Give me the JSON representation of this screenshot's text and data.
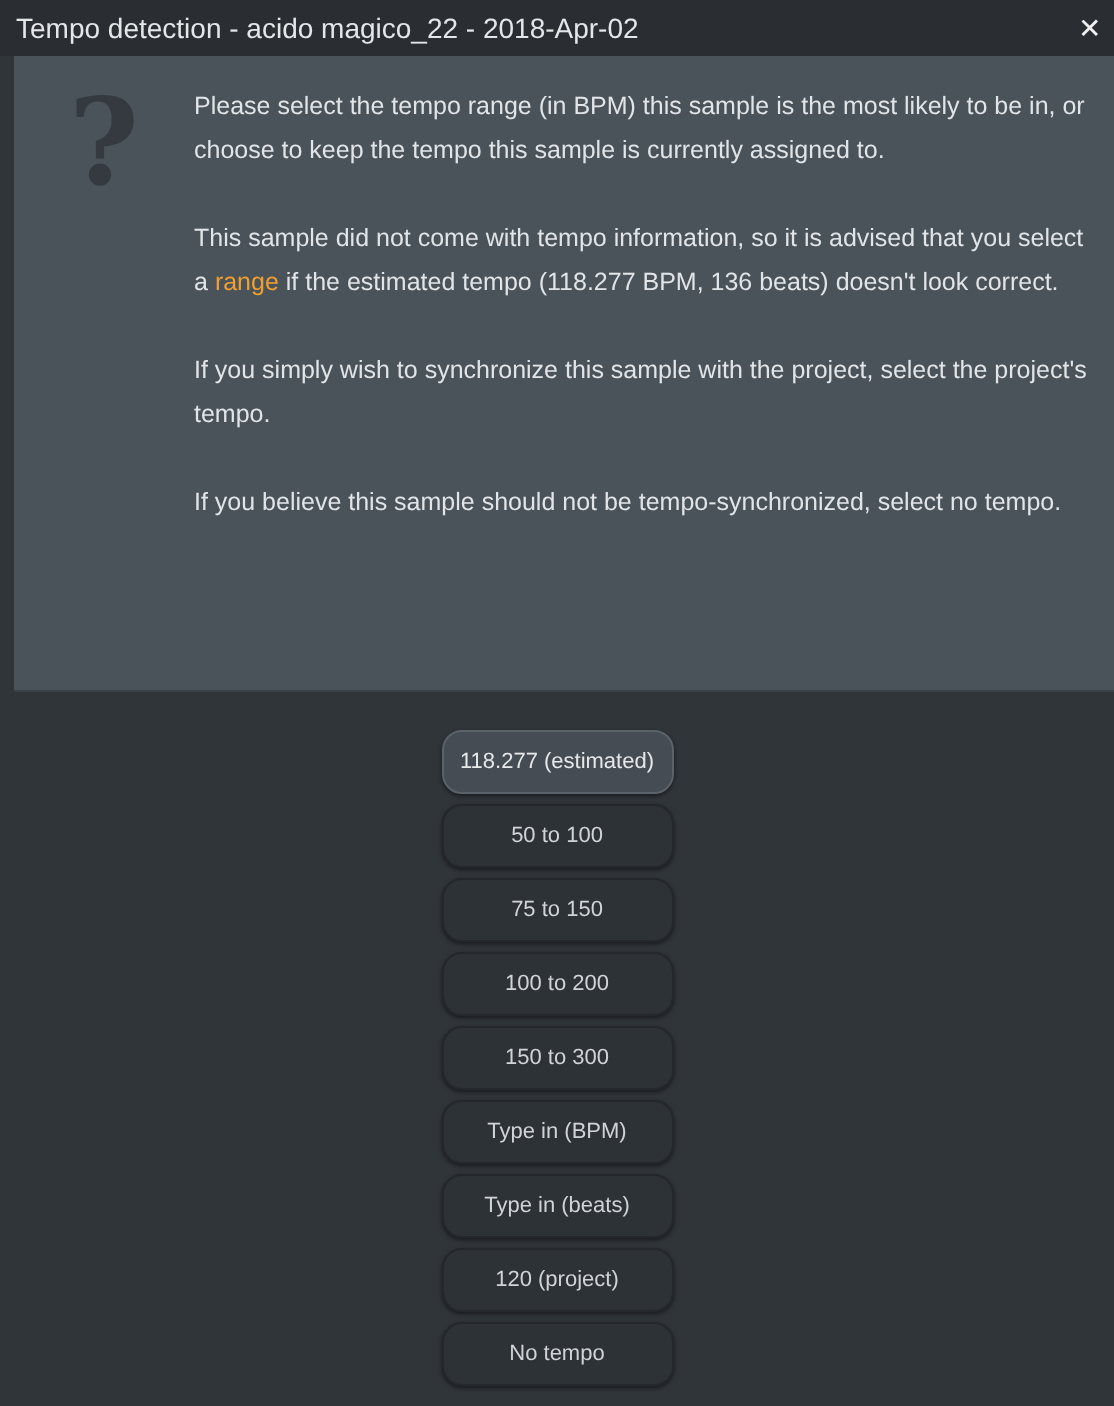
{
  "window": {
    "title": "Tempo detection - acido magico_22 - 2018-Apr-02",
    "close": "✕"
  },
  "message": {
    "icon": "?",
    "paragraphs": [
      [
        {
          "kind": "plain",
          "text": "Please select the tempo range (in BPM) this sample is the most likely to be in, or choose to keep the tempo this sample is currently assigned to."
        }
      ],
      [
        {
          "kind": "plain",
          "text": "This sample did not come with tempo information, so it is advised that you select a "
        },
        {
          "kind": "link",
          "text": "range"
        },
        {
          "kind": "plain",
          "text": " if the estimated tempo (118.277 BPM, 136 beats) doesn't look correct."
        }
      ],
      [
        {
          "kind": "plain",
          "text": "If you simply wish to synchronize this sample with the project, select the project's tempo."
        }
      ],
      [
        {
          "kind": "plain",
          "text": "If you believe this sample should not be tempo-synchronized, select no tempo."
        }
      ]
    ]
  },
  "options": [
    {
      "label": "118.277 (estimated)",
      "selected": true
    },
    {
      "label": "50 to 100",
      "selected": false
    },
    {
      "label": "75 to 150",
      "selected": false
    },
    {
      "label": "100 to 200",
      "selected": false
    },
    {
      "label": "150 to 300",
      "selected": false
    },
    {
      "label": "Type in (BPM)",
      "selected": false
    },
    {
      "label": "Type in (beats)",
      "selected": false
    },
    {
      "label": "120 (project)",
      "selected": false
    },
    {
      "label": "No tempo",
      "selected": false
    }
  ]
}
